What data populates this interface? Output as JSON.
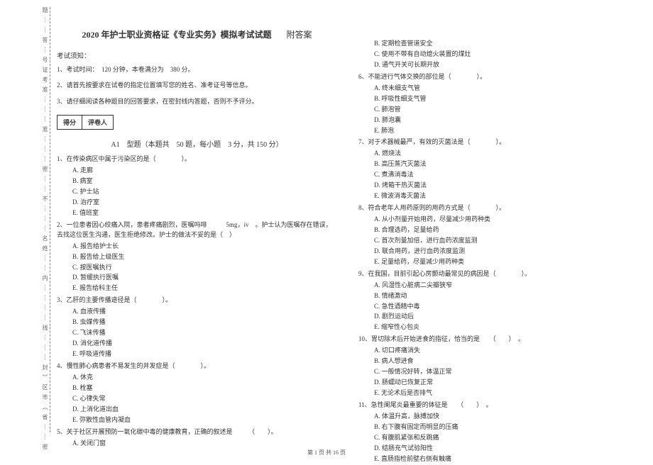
{
  "binding": {
    "ellipsis": "⋯⋯⋯⋯⋯⋯⋯⋯",
    "labels_vertical": "题⋯⋯答⋯号证考准⋯⋯⋯准⋯⋯⋯密⋯⋯不⋯⋯⋯名姓⋯⋯内⋯⋯⋯⋯线⋯⋯⋯封）区市（省⋯⋯密"
  },
  "header": {
    "title": "2020 年护士职业资格证《专业实务》模拟考试试题",
    "subtitle": "附答案"
  },
  "instructions": {
    "heading": "考试须知：",
    "items": [
      "1、考试时间：　120 分钟，本卷满分为　380 分。",
      "2、请首先按要求在试卷的指定位置填写您的姓名、准考证号等信息。",
      "3、请仔细阅读各种题目的回答要求，在密封线内答题，否则不予评分。"
    ]
  },
  "score_table": {
    "score": "得分",
    "marker": "评卷人"
  },
  "section_a1": "A1　型题（本题共　50 题，每小题　3 分，共 150 分）",
  "questions_left": [
    {
      "num": "1",
      "stem": "、在传染病区中属于污染区的是（　　　　）。",
      "opts": [
        "走廊",
        "病室",
        "护士站",
        "治疗室",
        "值班室"
      ]
    },
    {
      "num": "2",
      "stem": "、一位患者因心绞痛入院，患者疼痛剧烈，医嘱吗啡　　　5mg，iv　。护士认为医嘱存在错误，去找这位医生沟通，医生拒绝修改。护士的做法不妥的是（　）",
      "opts": [
        "报告给护士长",
        "报告给上级医生",
        "按医嘱执行",
        "暂缓执行医嘱",
        "报告给科主任"
      ]
    },
    {
      "num": "3",
      "stem": "、乙肝的主要传播途径是（　　　　）。",
      "opts": [
        "血液传播",
        "虫媒传播",
        "飞沫传播",
        "消化道传播",
        "呼吸道传播"
      ]
    },
    {
      "num": "4",
      "stem": "、慢性肺心病患者不易发生的并发症是（　　　　）。",
      "opts": [
        "休克",
        "栓塞",
        "心律失常",
        "上消化道出血",
        "弥散性血管内凝血"
      ]
    },
    {
      "num": "5",
      "stem": "、关于社区开展预防一氧化碳中毒的健康教育，正确的叙述是　　　（　　）。",
      "opts": [
        "关闭门窗"
      ]
    }
  ],
  "questions_right": [
    {
      "num": "",
      "stem": "",
      "opts": [
        "定期检查管道安全",
        "使用不带有自动熄火装置的煤灶",
        "通气开关可长期开放"
      ],
      "start": "B"
    },
    {
      "num": "6",
      "stem": "、不能进行气体交换的部位是（　　　　）。",
      "opts": [
        "终末细支气管",
        "呼吸性细支气管",
        "肺泡管",
        "肺泡囊",
        "肺泡"
      ]
    },
    {
      "num": "7",
      "stem": "、对于术器械最严，有效的灭菌法是（　　　　）。",
      "opts": [
        "燃烧法",
        "高压蒸汽灭菌法",
        "煮沸消毒法",
        "烤箱干热灭菌法",
        "微波消毒灭菌法"
      ]
    },
    {
      "num": "8",
      "stem": "、符合老年人用药原则的用药方式是（　　　　）。",
      "opts": [
        "从小剂量开始用药，尽量减少用药种类",
        "合理选药，足量给药",
        "首次剂量加倍，进行血药浓度监测",
        "联合用药，进行血药浓度监测",
        "足量给药，尽量减少用药种类"
      ]
    },
    {
      "num": "9",
      "stem": "、在我国，目前引起心房颤动最常见的病因是（　　　　）。",
      "opts": [
        "风湿性心脏病二尖瓣狭窄",
        "情绪激动",
        "急性酒精中毒",
        "剧烈运动后",
        "缩窄性心包炎"
      ]
    },
    {
      "num": "10",
      "stem": "、胃切除术后开始进食的指征，恰当的是　　（　　）　。",
      "opts": [
        "切口疼痛消失",
        "病人想进食",
        "一般情况好转，体温正常",
        "肠蠕动已恢复正常",
        "无论术后是否排气"
      ]
    },
    {
      "num": "11",
      "stem": "、急性阑尾炎最重要的体征是　　（　　）　。",
      "opts": [
        "体温升高，脉搏加快",
        "右下腹有固定而明显的压痛",
        "有腹肌紧张和反跳痛",
        "结肠充气试验阳性",
        "直肠指检前壁右侧有触痛"
      ]
    }
  ],
  "opt_letters": [
    "A",
    "B",
    "C",
    "D",
    "E"
  ],
  "footer": "第 1 页 共 16 页"
}
